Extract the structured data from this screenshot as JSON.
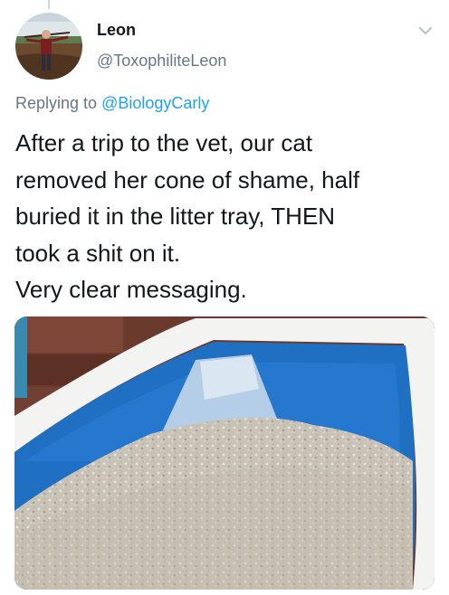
{
  "tweet": {
    "author_name": "Leon",
    "author_handle": "@ToxophiliteLeon",
    "reply_prefix": "Replying to",
    "reply_mention": "@BiologyCarly",
    "text_lines": [
      "After a trip to the vet, our cat",
      "removed her cone of shame, half",
      "buried it in the litter tray, THEN",
      "took a shit on it.",
      "Very clear messaging."
    ]
  },
  "icons": {
    "menu": "chevron-down-icon",
    "avatar": "avatar-archer"
  },
  "colors": {
    "text": "#14171a",
    "secondary_text": "#657786",
    "link": "#1da1f2",
    "thread_line": "#ccd6dd",
    "litter_tray_blue": "#1f6fc2"
  }
}
